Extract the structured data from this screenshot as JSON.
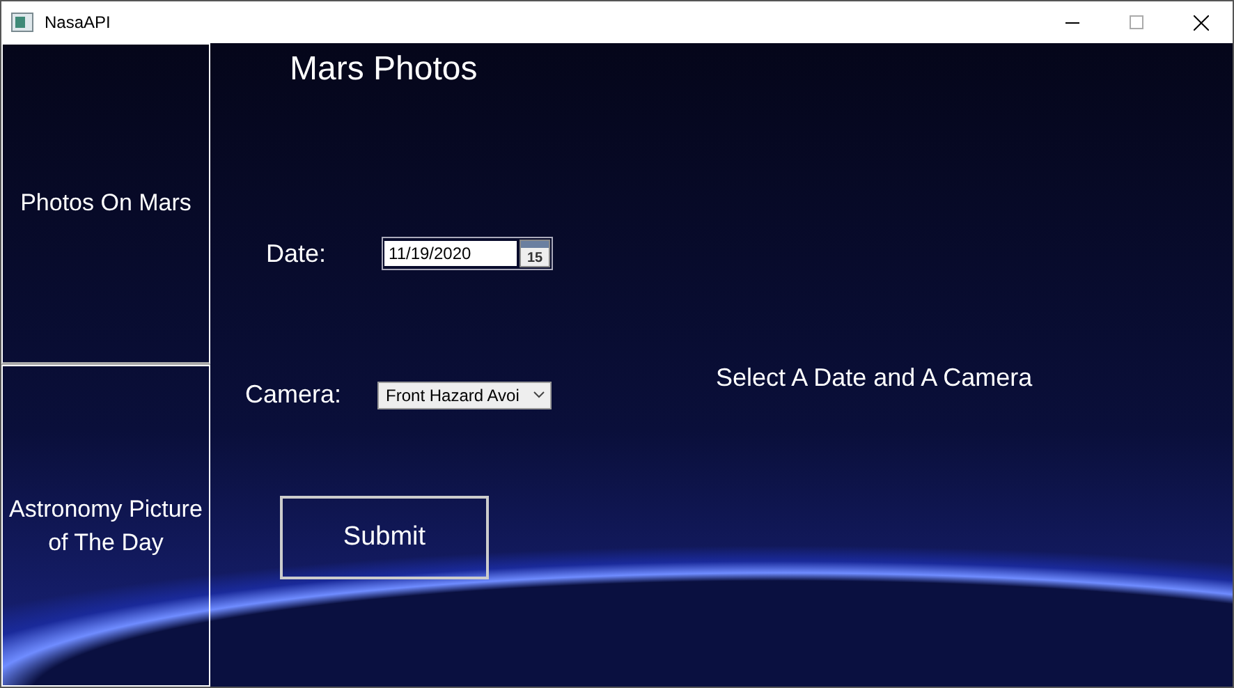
{
  "window": {
    "title": "NasaAPI"
  },
  "sidebar": {
    "items": [
      {
        "label": "Photos On Mars"
      },
      {
        "label": "Astronomy Picture of The Day"
      }
    ]
  },
  "page_title": "Mars Photos",
  "date": {
    "label": "Date:",
    "value": "11/19/2020",
    "calendar_day": "15"
  },
  "hint": "Select A Date and A Camera",
  "camera": {
    "label": "Camera:",
    "value": "Front Hazard Avoi"
  },
  "submit": {
    "label": "Submit"
  }
}
